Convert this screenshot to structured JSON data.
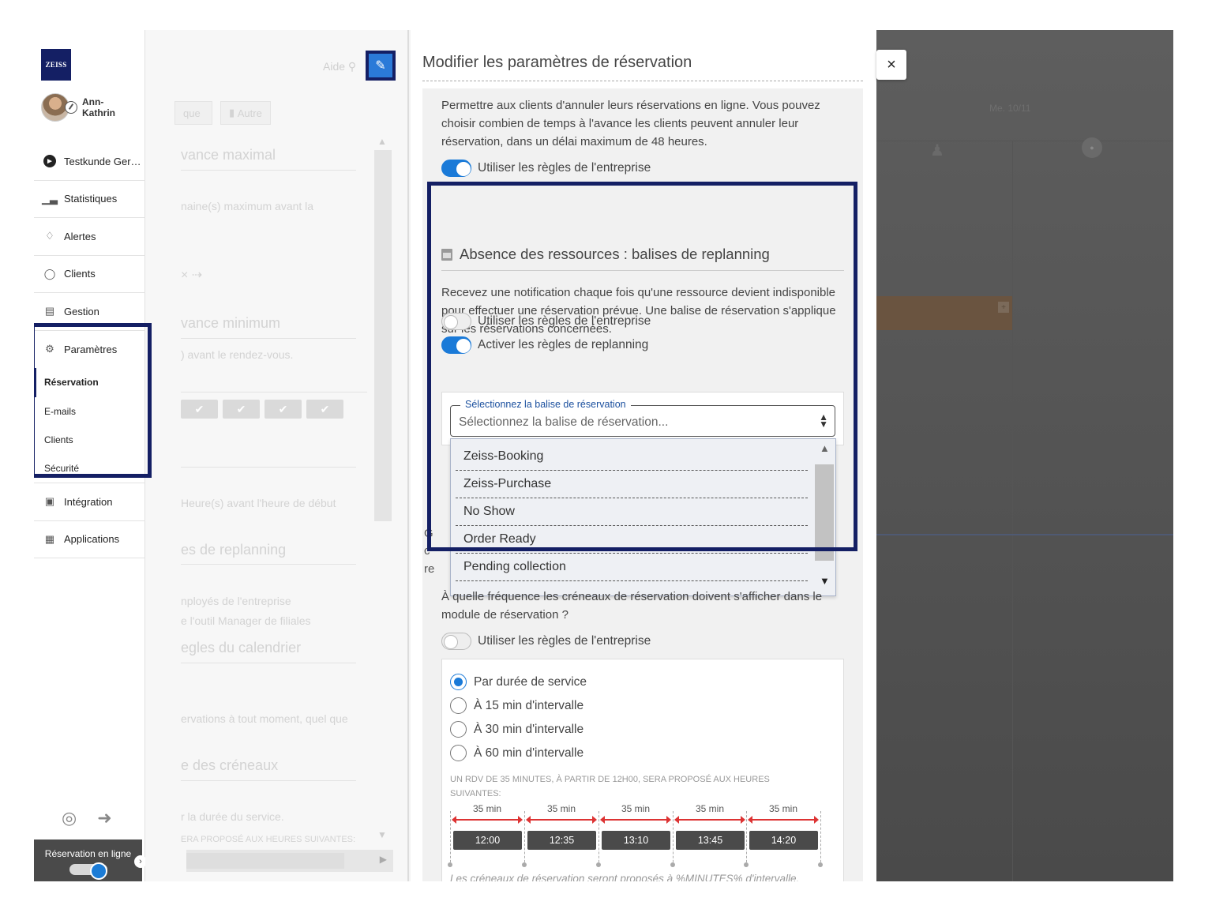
{
  "sidebar": {
    "logo": "ZEISS",
    "user_name_line1": "Ann-",
    "user_name_line2": "Kathrin",
    "items": [
      {
        "label": "Testkunde Ger…",
        "icon": "circle-arrow-icon"
      },
      {
        "label": "Statistiques",
        "icon": "bar-chart-icon"
      },
      {
        "label": "Alertes",
        "icon": "bell-icon"
      },
      {
        "label": "Clients",
        "icon": "user-icon"
      },
      {
        "label": "Gestion",
        "icon": "register-icon"
      },
      {
        "label": "Paramètres",
        "icon": "gears-icon"
      }
    ],
    "subitems": [
      "Réservation",
      "E-mails",
      "Clients",
      "Sécurité"
    ],
    "bottom_items": [
      {
        "label": "Intégration",
        "icon": "integration-icon"
      },
      {
        "label": "Applications",
        "icon": "grid-icon"
      }
    ],
    "online_label": "Réservation en ligne"
  },
  "background_panel": {
    "help_label": "Aide",
    "tab_partial": "que",
    "tab_other": "Autre",
    "ghost_texts": [
      "vance maximal",
      "naine(s) maximum avant la",
      "vance minimum",
      ") avant le rendez-vous.",
      "Heure(s) avant l'heure de début",
      "es de replanning",
      "nployés de l'entreprise",
      "e l'outil Manager de filiales",
      "egles du calendrier",
      "ervations à tout moment, quel que",
      "e des créneaux",
      "r la durée du service.",
      "ERA PROPOSÉ AUX HEURES SUIVANTES:"
    ]
  },
  "modal": {
    "title": "Modifier les paramètres de réservation",
    "cancel_description": "Permettre aux clients d'annuler leurs réservations en ligne. Vous pouvez choisir combien de temps à l'avance les clients peuvent annuler leur réservation, dans un délai maximum de 48 heures.",
    "use_company_rules": "Utiliser les règles de l'entreprise",
    "absence_title": "Absence des ressources : balises de replanning",
    "absence_description": "Recevez une notification chaque fois qu'une ressource devient indisponible pour effectuer une réservation prévue. Une balise de réservation s'applique sur les réservations concernées.",
    "activate_replanning": "Activer les règles de replanning",
    "select_legend": "Sélectionnez la balise de réservation",
    "select_placeholder": "Sélectionnez la balise de réservation...",
    "dropdown_options": [
      "Zeiss-Booking",
      "Zeiss-Purchase",
      "No Show",
      "Order Ready",
      "Pending collection"
    ],
    "frequency_description": "À quelle fréquence les créneaux de réservation doivent s'afficher dans le module de réservation ?",
    "radio_options": [
      "Par durée de service",
      "À 15 min d'intervalle",
      "À 30 min d'intervalle",
      "À 60 min d'intervalle"
    ],
    "example_caption": "UN RDV DE 35 MINUTES, À PARTIR DE 12H00, SERA PROPOSÉ AUX HEURES SUIVANTES:",
    "slot_duration": "35 min",
    "slot_times": [
      "12:00",
      "12:35",
      "13:10",
      "13:45",
      "14:20"
    ],
    "footnote": "Les créneaux de réservation seront proposés à %MINUTES% d'intervalle."
  },
  "calendar": {
    "close_label": "×",
    "day_label": "Me. 10/11"
  },
  "colors": {
    "brand": "#141f64",
    "accent": "#1a7ad8",
    "slot_arrow": "#dd3333"
  }
}
